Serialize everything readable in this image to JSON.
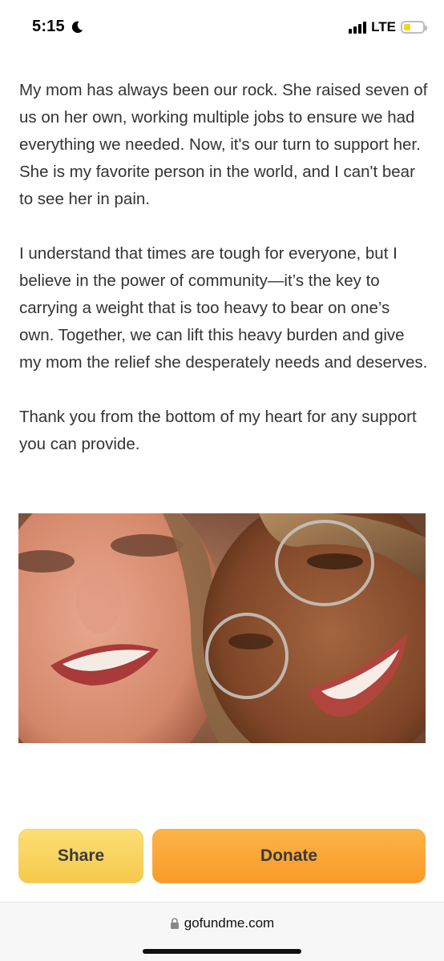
{
  "status_bar": {
    "time": "5:15",
    "network": "LTE",
    "icons": [
      "moon-icon",
      "signal-bars-icon",
      "battery-icon"
    ],
    "battery_level": 0.35
  },
  "story": {
    "paragraphs": [
      "My mom has always been our rock. She raised seven of us on her own, working multiple jobs to ensure we had everything we needed. Now, it's our turn to support her. She is my favorite person in the world, and I can't bear to see her in pain.",
      "I understand that times are tough for everyone, but I believe in the power of community—it’s the key to carrying a weight that is too heavy to bear on one’s own. Together, we can lift this heavy burden and give my mom the relief she desperately needs and deserves.",
      "Thank you from the bottom of my heart for any support you can provide."
    ]
  },
  "actions": {
    "share_label": "Share",
    "donate_label": "Donate"
  },
  "browser": {
    "url": "gofundme.com"
  },
  "colors": {
    "share_button": "#f8d35e",
    "donate_button": "#fca63a",
    "text": "#333333",
    "battery": "#f7d21a"
  }
}
